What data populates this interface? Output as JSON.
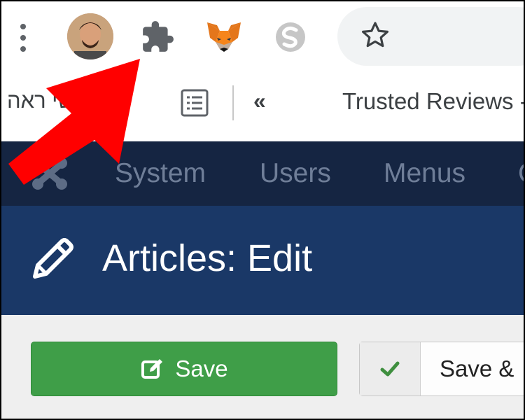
{
  "browser": {
    "menu_icon": "kebab-menu-icon",
    "extensions": [
      "puzzle-extensions-icon",
      "metamask-fox-icon",
      "s-extension-icon"
    ],
    "bookmark_star_icon": "star-icon"
  },
  "bookmarks": {
    "hebrew_label": "ראשי ראה",
    "reading_list_icon": "list-icon",
    "chevron": "«",
    "trusted_reviews": "Trusted Reviews -"
  },
  "joomla": {
    "nav": [
      "System",
      "Users",
      "Menus",
      "C"
    ],
    "page_title": "Articles: Edit",
    "save_label": "Save",
    "save_close_label": "Save &"
  },
  "colors": {
    "nav_bg": "#152542",
    "header_bg": "#1a3867",
    "save_green": "#3f9e48",
    "arrow_red": "#ff0000"
  }
}
